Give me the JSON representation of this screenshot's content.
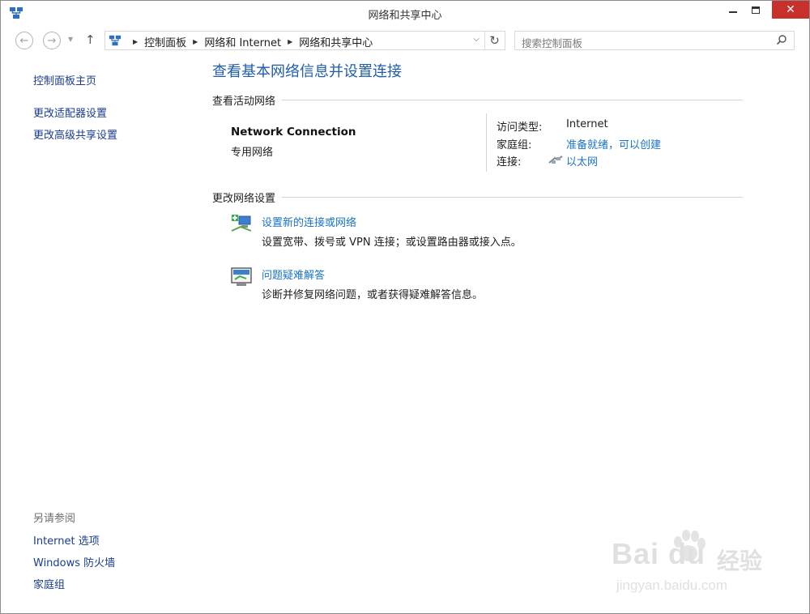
{
  "window": {
    "title": "网络和共享中心"
  },
  "address": {
    "crumbs": [
      "控制面板",
      "网络和 Internet",
      "网络和共享中心"
    ],
    "search_placeholder": "搜索控制面板"
  },
  "sidebar": {
    "home": "控制面板主页",
    "items": [
      "更改适配器设置",
      "更改高级共享设置"
    ],
    "see_also_label": "另请参阅",
    "see_also": [
      "Internet 选项",
      "Windows 防火墙",
      "家庭组"
    ]
  },
  "main": {
    "title": "查看基本网络信息并设置连接",
    "active_section": "查看活动网络",
    "network": {
      "name": "Network Connection",
      "profile": "专用网络",
      "access_type_label": "访问类型:",
      "access_type_value": "Internet",
      "homegroup_label": "家庭组:",
      "homegroup_value": "准备就绪，可以创建",
      "connection_label": "连接:",
      "connection_value": "以太网"
    },
    "change_section": "更改网络设置",
    "tasks": [
      {
        "title": "设置新的连接或网络",
        "desc": "设置宽带、拨号或 VPN 连接；或设置路由器或接入点。"
      },
      {
        "title": "问题疑难解答",
        "desc": "诊断并修复网络问题，或者获得疑难解答信息。"
      }
    ]
  },
  "watermark": {
    "brand": "Bai du",
    "cn": "经验",
    "url": "jingyan.baidu.com"
  },
  "colors": {
    "link": "#1a73c8",
    "title": "#1f5ea8",
    "close": "#c7302b"
  }
}
